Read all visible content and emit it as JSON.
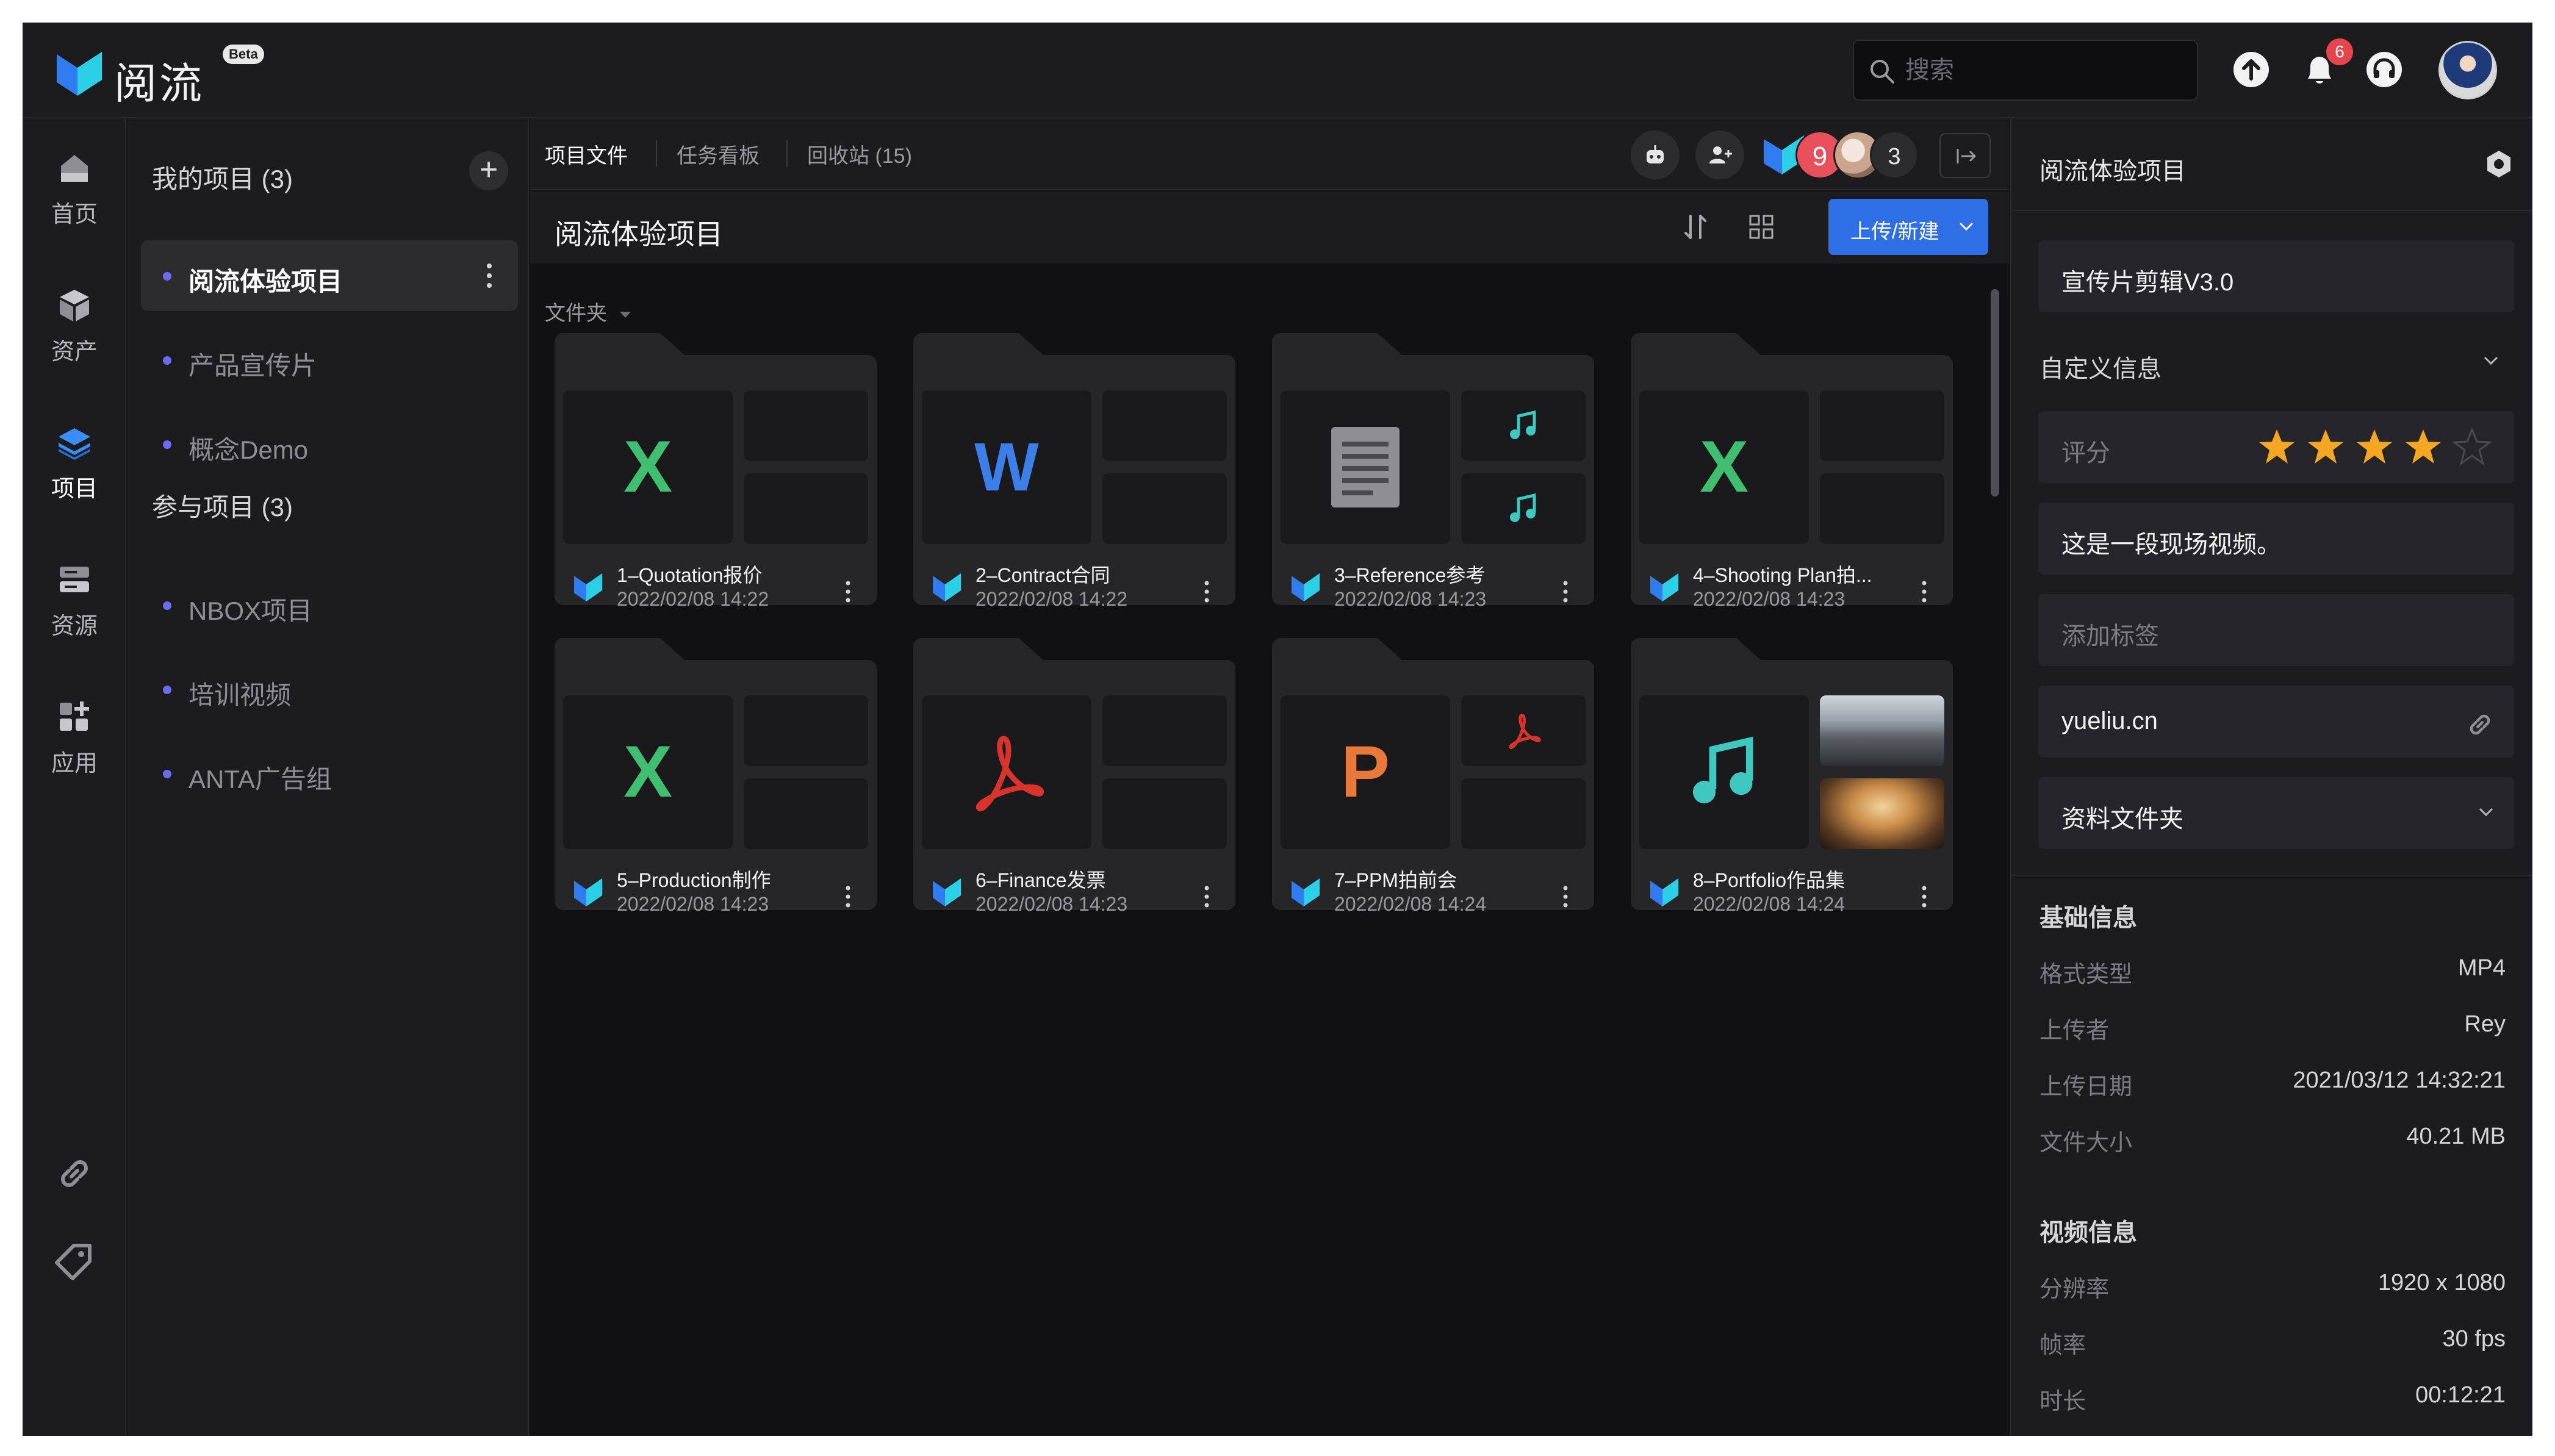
{
  "app": {
    "name": "阅流",
    "badge": "Beta"
  },
  "header": {
    "search_placeholder": "搜索",
    "notification_count": "6"
  },
  "rail": {
    "items": [
      {
        "label": "首页",
        "icon": "home-icon"
      },
      {
        "label": "资产",
        "icon": "cube-icon"
      },
      {
        "label": "项目",
        "icon": "layers-icon",
        "active": true
      },
      {
        "label": "资源",
        "icon": "server-icon"
      },
      {
        "label": "应用",
        "icon": "apps-icon"
      }
    ]
  },
  "projects": {
    "my_title": "我的项目 (3)",
    "my_items": [
      "阅流体验项目",
      "产品宣传片",
      "概念Demo"
    ],
    "joined_title": "参与项目 (3)",
    "joined_items": [
      "NBOX项目",
      "培训视频",
      "ANTA广告组"
    ]
  },
  "main": {
    "tabs": [
      "项目文件",
      "任务看板",
      "回收站 (15)"
    ],
    "member_badge": "9",
    "member_more": "3",
    "title": "阅流体验项目",
    "upload_label": "上传/新建",
    "group_label": "文件夹",
    "folders": [
      {
        "name": "1–Quotation报价",
        "date": "2022/02/08 14:22",
        "icon": "excel-icon"
      },
      {
        "name": "2–Contract合同",
        "date": "2022/02/08 14:22",
        "icon": "word-icon"
      },
      {
        "name": "3–Reference参考",
        "date": "2022/02/08 14:23",
        "icon": "document-icon"
      },
      {
        "name": "4–Shooting Plan拍...",
        "date": "2022/02/08 14:23",
        "icon": "excel-icon"
      },
      {
        "name": "5–Production制作",
        "date": "2022/02/08 14:23",
        "icon": "excel-icon"
      },
      {
        "name": "6–Finance发票",
        "date": "2022/02/08 14:23",
        "icon": "pdf-icon"
      },
      {
        "name": "7–PPM拍前会",
        "date": "2022/02/08 14:24",
        "icon": "powerpoint-icon"
      },
      {
        "name": "8–Portfolio作品集",
        "date": "2022/02/08 14:24",
        "icon": "music-icon"
      }
    ]
  },
  "panel": {
    "title": "阅流体验项目",
    "file_name": "宣传片剪辑V3.0",
    "custom_section": "自定义信息",
    "rating_label": "评分",
    "rating": 4,
    "rating_max": 5,
    "description": "这是一段现场视频。",
    "tag_placeholder": "添加标签",
    "link": "yueliu.cn",
    "folder_select": "资料文件夹",
    "basic_section": "基础信息",
    "basic": [
      {
        "key": "格式类型",
        "value": "MP4"
      },
      {
        "key": "上传者",
        "value": "Rey"
      },
      {
        "key": "上传日期",
        "value": "2021/03/12 14:32:21"
      },
      {
        "key": "文件大小",
        "value": "40.21 MB"
      }
    ],
    "video_section": "视频信息",
    "video": [
      {
        "key": "分辨率",
        "value": "1920 x 1080"
      },
      {
        "key": "帧率",
        "value": "30 fps"
      },
      {
        "key": "时长",
        "value": "00:12:21"
      }
    ]
  },
  "colors": {
    "accent": "#2f6fe6",
    "excel": "#3fbf6f",
    "word": "#3d7fe8",
    "pdf": "#d9342b",
    "powerpoint": "#e8793a",
    "music": "#3ec8c0",
    "star": "#f5a623"
  }
}
